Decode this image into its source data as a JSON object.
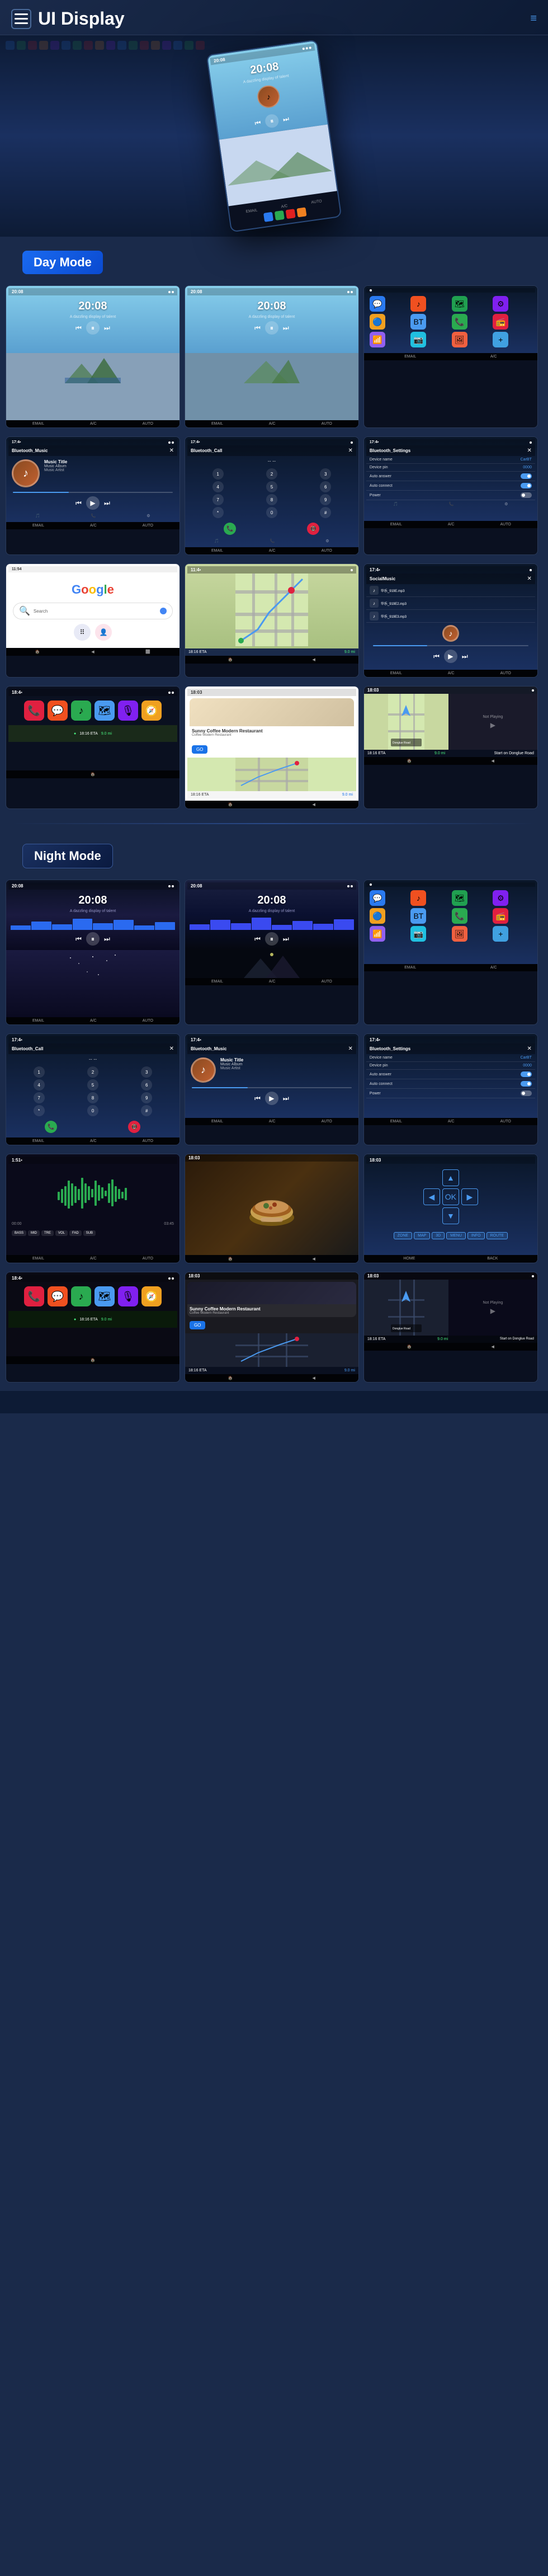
{
  "header": {
    "title": "UI Display",
    "menu_icon": "≡",
    "hamburger_lines": 3
  },
  "day_mode": {
    "label": "Day Mode"
  },
  "night_mode": {
    "label": "Night Mode"
  },
  "music_screens": {
    "time": "20:08",
    "music_title": "Music Title",
    "music_album": "Music Album",
    "music_artist": "Music Artist"
  },
  "bluetooth_music": {
    "title": "Bluetooth_Music"
  },
  "bluetooth_call": {
    "title": "Bluetooth_Call"
  },
  "bluetooth_settings": {
    "title": "Bluetooth_Settings",
    "device_name_label": "Device name",
    "device_name_value": "CarBT",
    "device_pin_label": "Device pin",
    "device_pin_value": "0000",
    "auto_answer_label": "Auto answer",
    "auto_connect_label": "Auto connect",
    "power_label": "Power"
  },
  "navigation": {
    "coffee_shop": "Sunny Coffee Modern Restaurant",
    "go_label": "GO",
    "eta_label": "18:16 ETA",
    "time_label": "18:16 ETA",
    "distance_label": "9.0 mi"
  },
  "social_music": {
    "title": "SocialMusic",
    "files": [
      "华乐_919E.mp3",
      "华乐_919E2.mp3",
      "华乐_919E3.mp3"
    ]
  }
}
